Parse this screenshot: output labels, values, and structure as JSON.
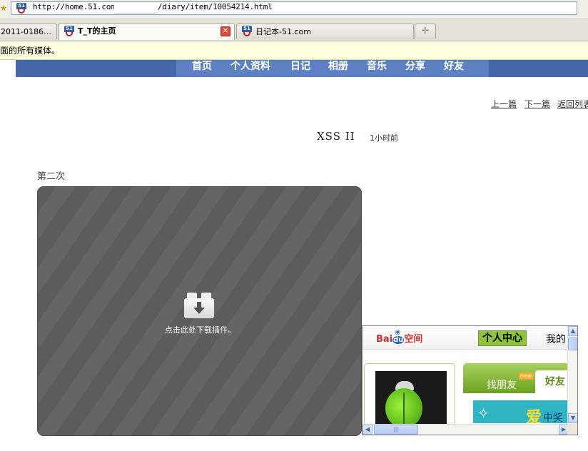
{
  "browser": {
    "address_part1": "http://home.51.com/",
    "address_part2": "/diary/item/10054214.html",
    "tabs": [
      {
        "label": "2011-0186…"
      },
      {
        "label": "T_T的主页",
        "active": true
      },
      {
        "label": "日记本-51.com"
      }
    ],
    "tab_icon": "favicon-51",
    "new_tab_symbol": "✛",
    "close_symbol": "✕"
  },
  "infobar": {
    "text": "面的所有媒体。"
  },
  "nav": {
    "items": [
      "首页",
      "个人资料",
      "日记",
      "相册",
      "音乐",
      "分享",
      "好友"
    ],
    "bg_color": "#4667a8",
    "highlight_color": "#5d80c3"
  },
  "pager": {
    "prev": "上一篇",
    "next": "下一篇",
    "back": "返回列表"
  },
  "diary": {
    "title": "XSS II",
    "time": "1小时前",
    "body": "第二次"
  },
  "plugin": {
    "icon": "plugin-download-icon",
    "message": "点击此处下载插件。"
  },
  "popup": {
    "logo": {
      "part1": "Bai",
      "part2": "du",
      "part3": "空间"
    },
    "center_button": "个人中心",
    "mine_label": "我的",
    "find_friends": "找朋友",
    "new_badge": "new",
    "friends_tab": "好友",
    "banner_love": "爱",
    "banner_mid": "中奖"
  }
}
